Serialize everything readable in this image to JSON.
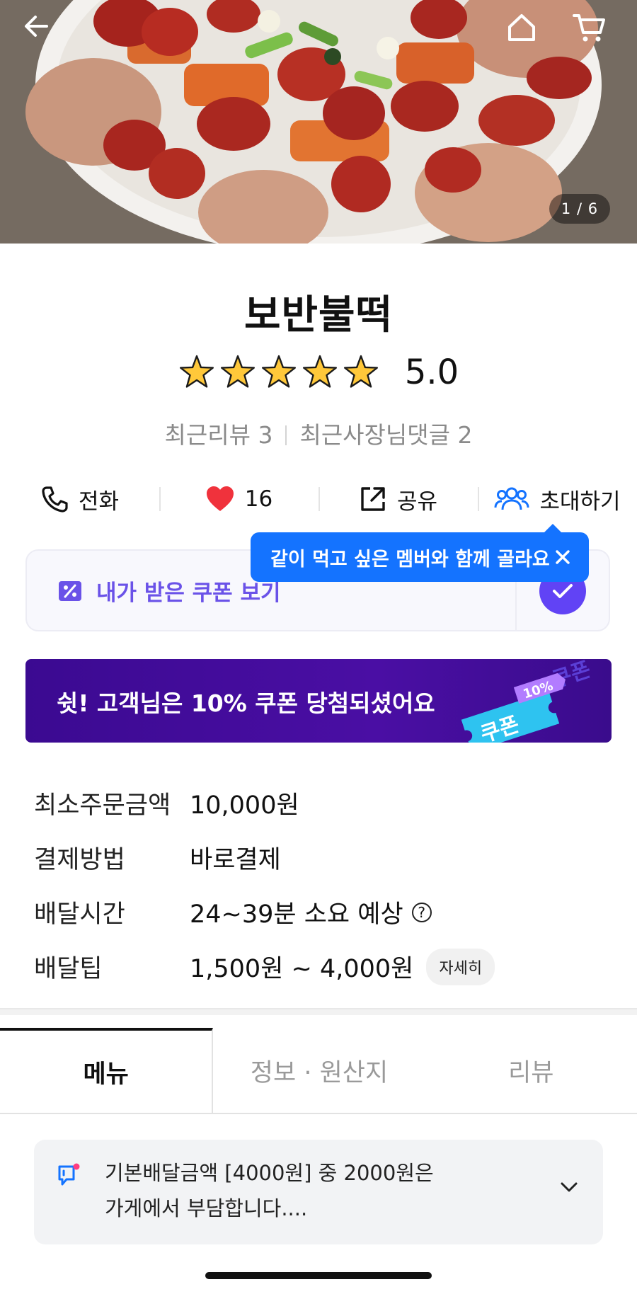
{
  "hero": {
    "counter": "1 / 6",
    "back_icon": "arrow-left-icon",
    "home_icon": "home-icon",
    "cart_icon": "cart-icon"
  },
  "store": {
    "name": "보반불떡",
    "stars": 5,
    "rating": "5.0",
    "recent_reviews": "최근리뷰 3",
    "recent_owner_replies": "최근사장님댓글 2"
  },
  "actions": {
    "call": "전화",
    "likes": "16",
    "share": "공유",
    "invite": "초대하기"
  },
  "tooltip": {
    "text": "같이 먹고 싶은 멤버와 함께 골라요"
  },
  "coupon": {
    "label": "내가 받은 쿠폰 보기"
  },
  "banner": {
    "text": "쉿! 고객님은 10% 쿠폰 당첨되셨어요",
    "ticket_label": "쿠폰",
    "ticket_badge": "10%"
  },
  "info": [
    {
      "key": "최소주문금액",
      "value": "10,000원"
    },
    {
      "key": "결제방법",
      "value": "바로결제"
    },
    {
      "key": "배달시간",
      "value": "24~39분 소요 예상"
    },
    {
      "key": "배달팁",
      "value": "1,500원 ~ 4,000원",
      "button": "자세히"
    }
  ],
  "tabs": [
    "메뉴",
    "정보 · 원산지",
    "리뷰"
  ],
  "notice": {
    "line1": "기본배달금액 [4000원] 중 2000원은",
    "line2": "가게에서 부담합니다...."
  },
  "colors": {
    "accent_purple": "#6143f5",
    "tooltip_blue": "#1473ff",
    "banner_purple": "#4a0ea4",
    "heart_red": "#f0323c"
  }
}
